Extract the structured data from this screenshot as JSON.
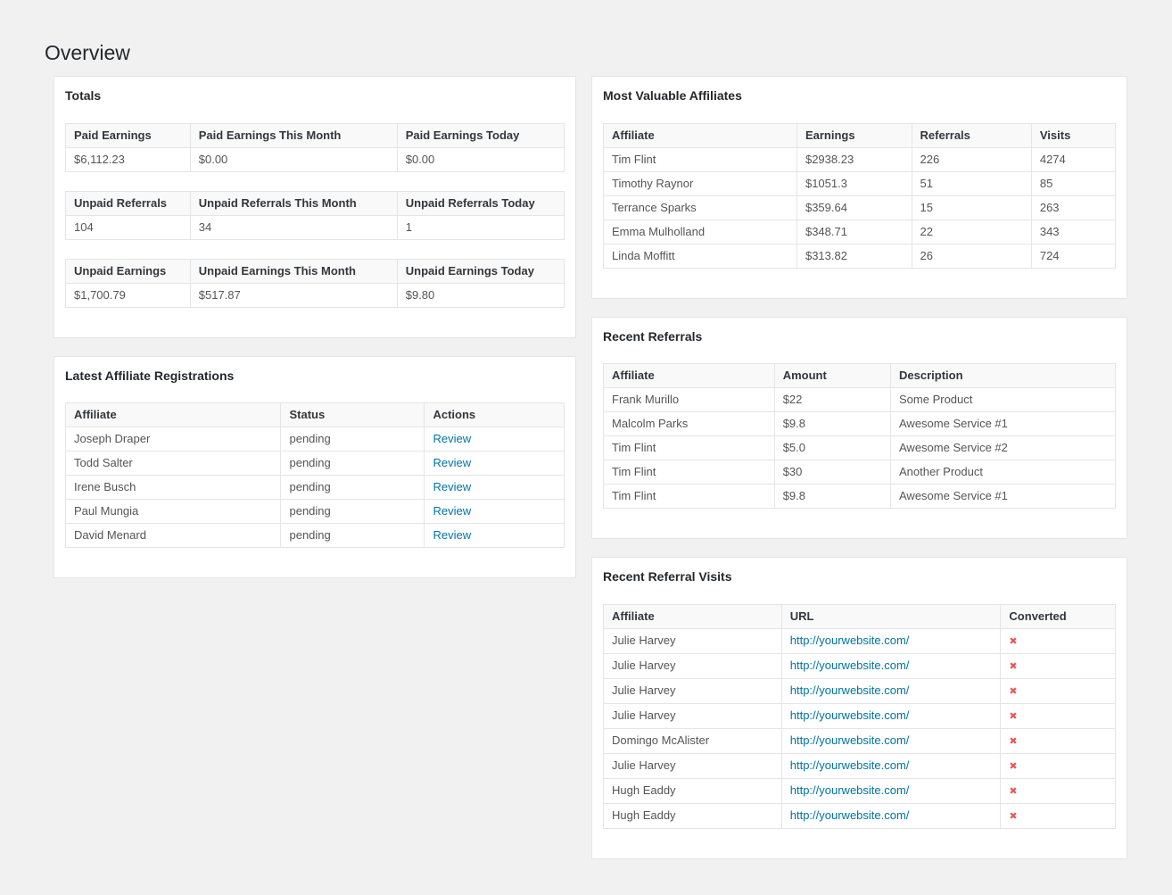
{
  "page": {
    "title": "Overview"
  },
  "colors": {
    "background": "#f1f1f1",
    "panel_border": "#e5e5e5",
    "header_row_bg": "#f9f9f9",
    "link_blue": "#0074a2",
    "not_converted_red": "#e35b5b"
  },
  "panels": {
    "totals": {
      "title": "Totals",
      "tables": [
        {
          "headers": [
            "Paid Earnings",
            "Paid Earnings This Month",
            "Paid Earnings Today"
          ],
          "values": [
            "$6,112.23",
            "$0.00",
            "$0.00"
          ]
        },
        {
          "headers": [
            "Unpaid Referrals",
            "Unpaid Referrals This Month",
            "Unpaid Referrals Today"
          ],
          "values": [
            "104",
            "34",
            "1"
          ]
        },
        {
          "headers": [
            "Unpaid Earnings",
            "Unpaid Earnings This Month",
            "Unpaid Earnings Today"
          ],
          "values": [
            "$1,700.79",
            "$517.87",
            "$9.80"
          ]
        }
      ]
    },
    "registrations": {
      "title": "Latest Affiliate Registrations",
      "headers": [
        "Affiliate",
        "Status",
        "Actions"
      ],
      "rows": [
        {
          "affiliate": "Joseph Draper",
          "status": "pending",
          "action": "Review"
        },
        {
          "affiliate": "Todd Salter",
          "status": "pending",
          "action": "Review"
        },
        {
          "affiliate": "Irene Busch",
          "status": "pending",
          "action": "Review"
        },
        {
          "affiliate": "Paul Mungia",
          "status": "pending",
          "action": "Review"
        },
        {
          "affiliate": "David Menard",
          "status": "pending",
          "action": "Review"
        }
      ]
    },
    "most_valuable": {
      "title": "Most Valuable Affiliates",
      "headers": [
        "Affiliate",
        "Earnings",
        "Referrals",
        "Visits"
      ],
      "rows": [
        {
          "affiliate": "Tim Flint",
          "earnings": "$2938.23",
          "referrals": "226",
          "visits": "4274"
        },
        {
          "affiliate": "Timothy Raynor",
          "earnings": "$1051.3",
          "referrals": "51",
          "visits": "85"
        },
        {
          "affiliate": "Terrance Sparks",
          "earnings": "$359.64",
          "referrals": "15",
          "visits": "263"
        },
        {
          "affiliate": "Emma Mulholland",
          "earnings": "$348.71",
          "referrals": "22",
          "visits": "343"
        },
        {
          "affiliate": "Linda Moffitt",
          "earnings": "$313.82",
          "referrals": "26",
          "visits": "724"
        }
      ]
    },
    "recent_referrals": {
      "title": "Recent Referrals",
      "headers": [
        "Affiliate",
        "Amount",
        "Description"
      ],
      "rows": [
        {
          "affiliate": "Frank Murillo",
          "amount": "$22",
          "description": "Some Product"
        },
        {
          "affiliate": "Malcolm Parks",
          "amount": "$9.8",
          "description": "Awesome Service #1"
        },
        {
          "affiliate": "Tim Flint",
          "amount": "$5.0",
          "description": "Awesome Service #2"
        },
        {
          "affiliate": "Tim Flint",
          "amount": "$30",
          "description": "Another Product"
        },
        {
          "affiliate": "Tim Flint",
          "amount": "$9.8",
          "description": "Awesome Service #1"
        }
      ]
    },
    "recent_visits": {
      "title": "Recent Referral Visits",
      "headers": [
        "Affiliate",
        "URL",
        "Converted"
      ],
      "not_converted_glyph": "✖",
      "rows": [
        {
          "affiliate": "Julie Harvey",
          "url": "http://yourwebsite.com/",
          "converted": "no"
        },
        {
          "affiliate": "Julie Harvey",
          "url": "http://yourwebsite.com/",
          "converted": "no"
        },
        {
          "affiliate": "Julie Harvey",
          "url": "http://yourwebsite.com/",
          "converted": "no"
        },
        {
          "affiliate": "Julie Harvey",
          "url": "http://yourwebsite.com/",
          "converted": "no"
        },
        {
          "affiliate": "Domingo McAlister",
          "url": "http://yourwebsite.com/",
          "converted": "no"
        },
        {
          "affiliate": "Julie Harvey",
          "url": "http://yourwebsite.com/",
          "converted": "no"
        },
        {
          "affiliate": "Hugh Eaddy",
          "url": "http://yourwebsite.com/",
          "converted": "no"
        },
        {
          "affiliate": "Hugh Eaddy",
          "url": "http://yourwebsite.com/",
          "converted": "no"
        }
      ]
    }
  }
}
